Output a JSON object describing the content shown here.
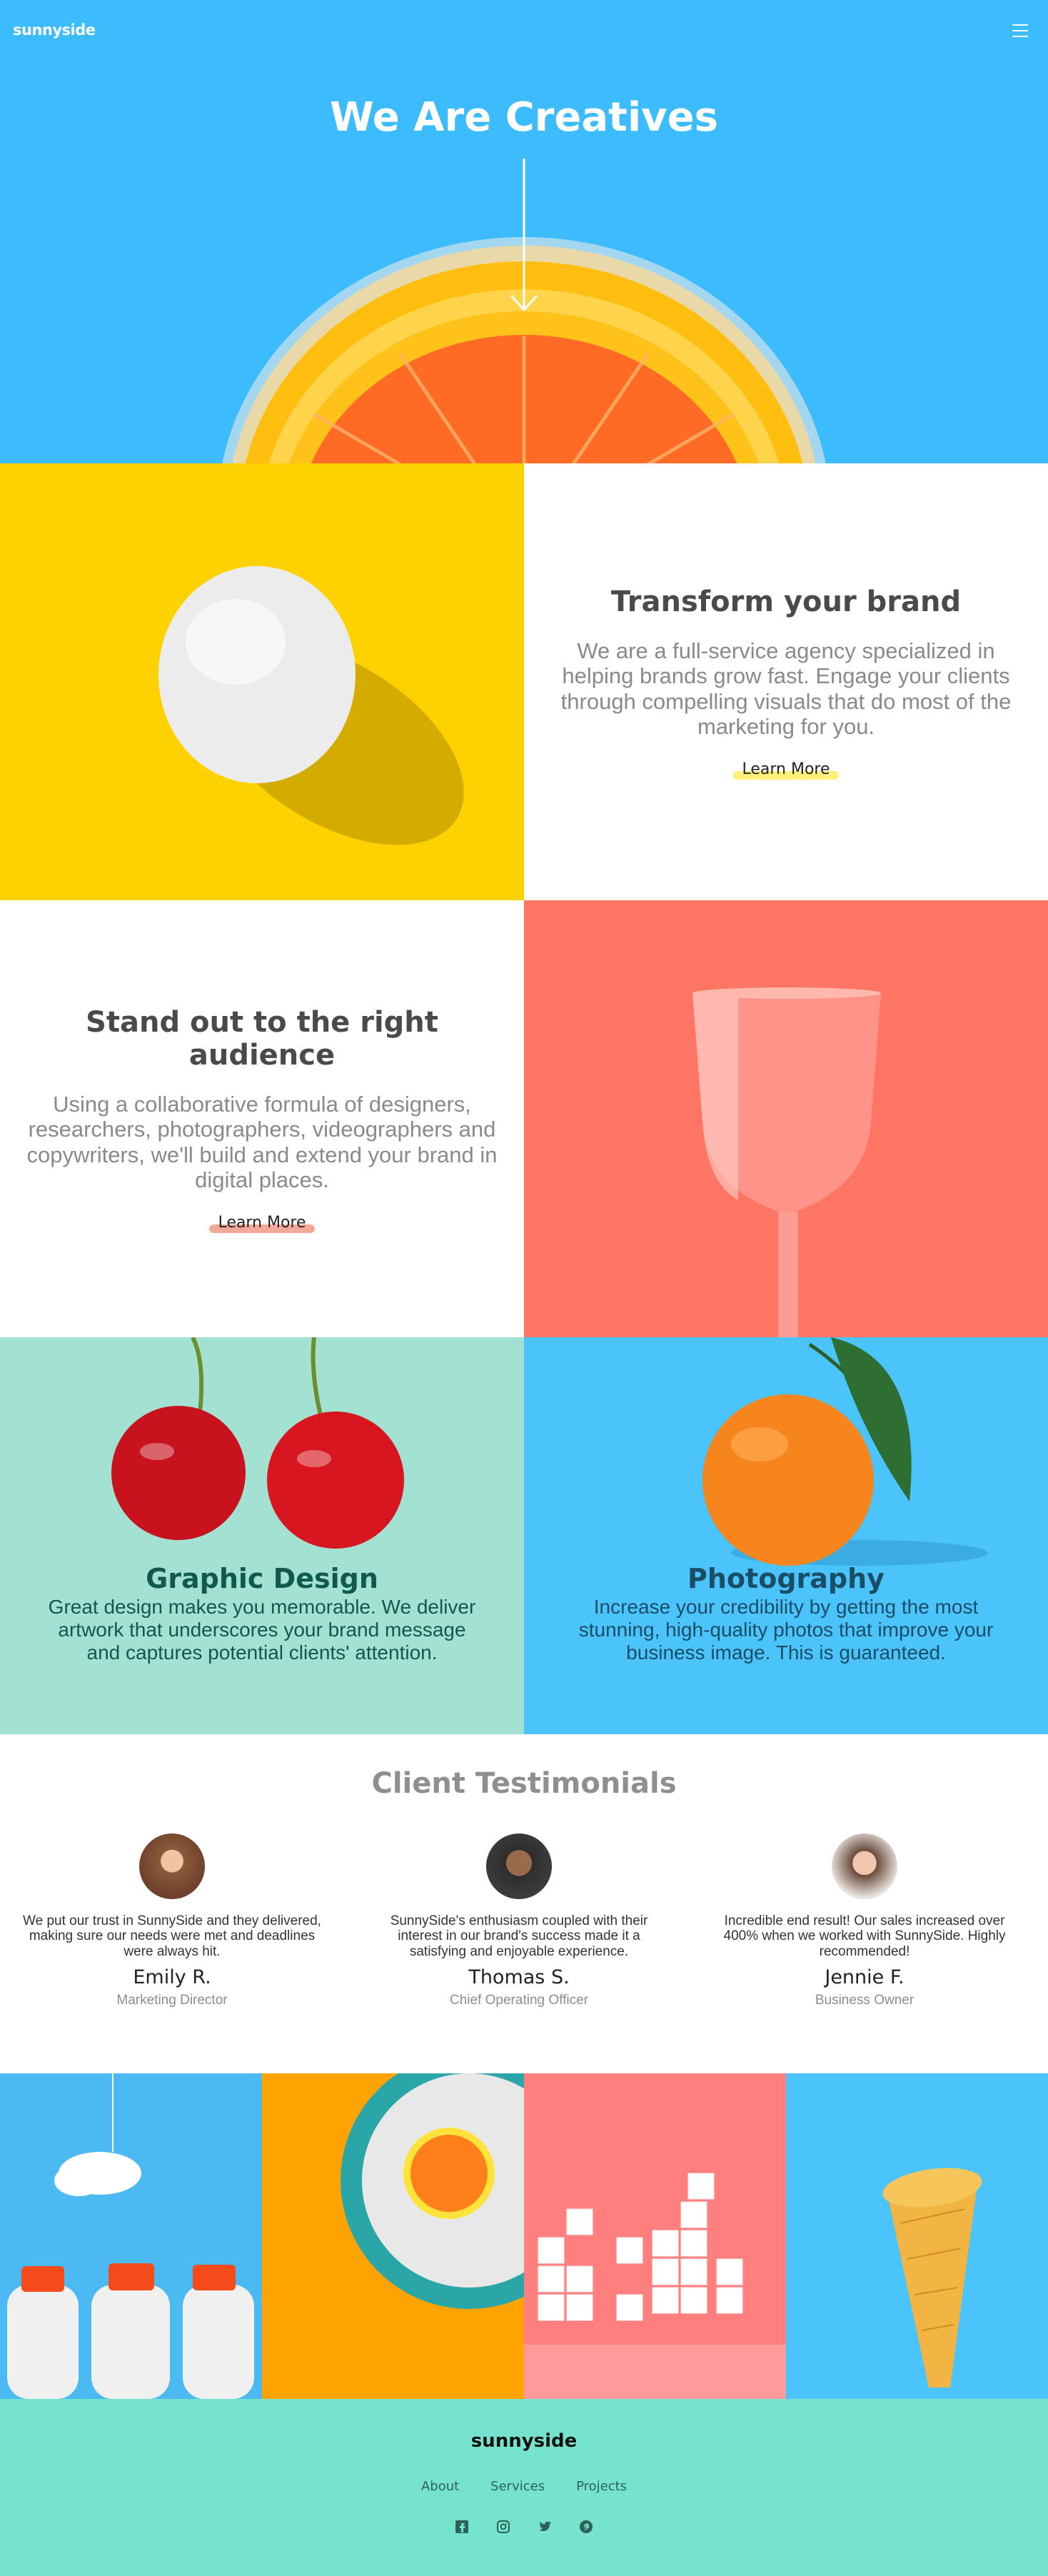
{
  "header": {
    "logo": "sunnyside",
    "hero_title": "We Are Creatives",
    "menu_icon": "hamburger-icon",
    "arrow_icon": "arrow-down-icon"
  },
  "features": [
    {
      "title": "Transform your brand",
      "text": "We are a full-service agency specialized in helping brands grow fast. Engage your clients through compelling visuals that do most of the marketing for you.",
      "link": "Learn More",
      "highlight_color": "#fef06c"
    },
    {
      "title": "Stand out to the right audience",
      "text": "Using a collaborative formula of designers, researchers, photographers, videographers and copywriters, we'll build and extend your brand in digital places.",
      "link": "Learn More",
      "highlight_color": "#f2a08d"
    }
  ],
  "services": [
    {
      "title": "Graphic Design",
      "text": "Great design makes you memorable. We deliver artwork that underscores your brand message and captures potential clients' attention.",
      "color": "#0f5a4d"
    },
    {
      "title": "Photography",
      "text": "Increase your credibility by getting the most stunning, high-quality photos that improve your business image. This is guaranteed.",
      "color": "#1a4d66"
    }
  ],
  "testimonials": {
    "heading": "Client Testimonials",
    "items": [
      {
        "quote": "We put our trust in SunnySide and they delivered, making sure our needs were met and deadlines were always hit.",
        "name": "Emily R.",
        "role": "Marketing Director"
      },
      {
        "quote": "SunnySide's enthusiasm coupled with their interest in our brand's success made it a satisfying and enjoyable experience.",
        "name": "Thomas S.",
        "role": "Chief Operating Officer"
      },
      {
        "quote": "Incredible end result! Our sales increased over 400% when we worked with SunnySide. Highly recommended!",
        "name": "Jennie F.",
        "role": "Business Owner"
      }
    ]
  },
  "footer": {
    "logo": "sunnyside",
    "nav": [
      "About",
      "Services",
      "Projects"
    ],
    "social": [
      "facebook-icon",
      "instagram-icon",
      "twitter-icon",
      "pinterest-icon"
    ]
  },
  "colors": {
    "hero_bg": "#3dbcfd",
    "egg_bg": "#fdd200",
    "glass_bg": "#ff7563",
    "cherry_bg": "#a3e1d3",
    "orange_bg": "#4bc4fb",
    "footer_bg": "#75e3cd"
  }
}
